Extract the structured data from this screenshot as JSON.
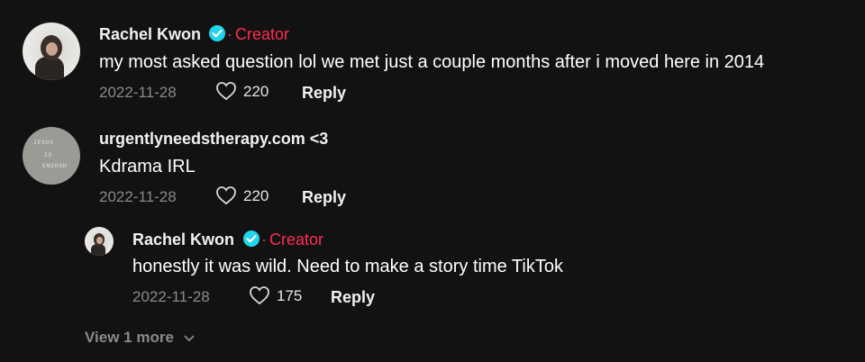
{
  "comments": [
    {
      "username": "Rachel Kwon",
      "verified": true,
      "creator_label": "Creator",
      "text": "my most asked question lol we met just a couple months after i moved here in 2014",
      "date": "2022-11-28",
      "likes": "220",
      "reply_label": "Reply"
    },
    {
      "username": "urgentlyneedstherapy.com <3",
      "verified": false,
      "text": "Kdrama IRL",
      "date": "2022-11-28",
      "likes": "220",
      "reply_label": "Reply"
    }
  ],
  "replies": [
    {
      "username": "Rachel Kwon",
      "verified": true,
      "creator_label": "Creator",
      "text": "honestly it was wild. Need to make a story time TikTok",
      "date": "2022-11-28",
      "likes": "175",
      "reply_label": "Reply"
    }
  ],
  "view_more_label": "View 1 more",
  "colors": {
    "background": "#121212",
    "creator": "#fe2c55",
    "verified": "#20d5ec",
    "muted": "#8a8a8a"
  },
  "icons": [
    "verified-badge-icon",
    "heart-icon",
    "chevron-down-icon"
  ]
}
